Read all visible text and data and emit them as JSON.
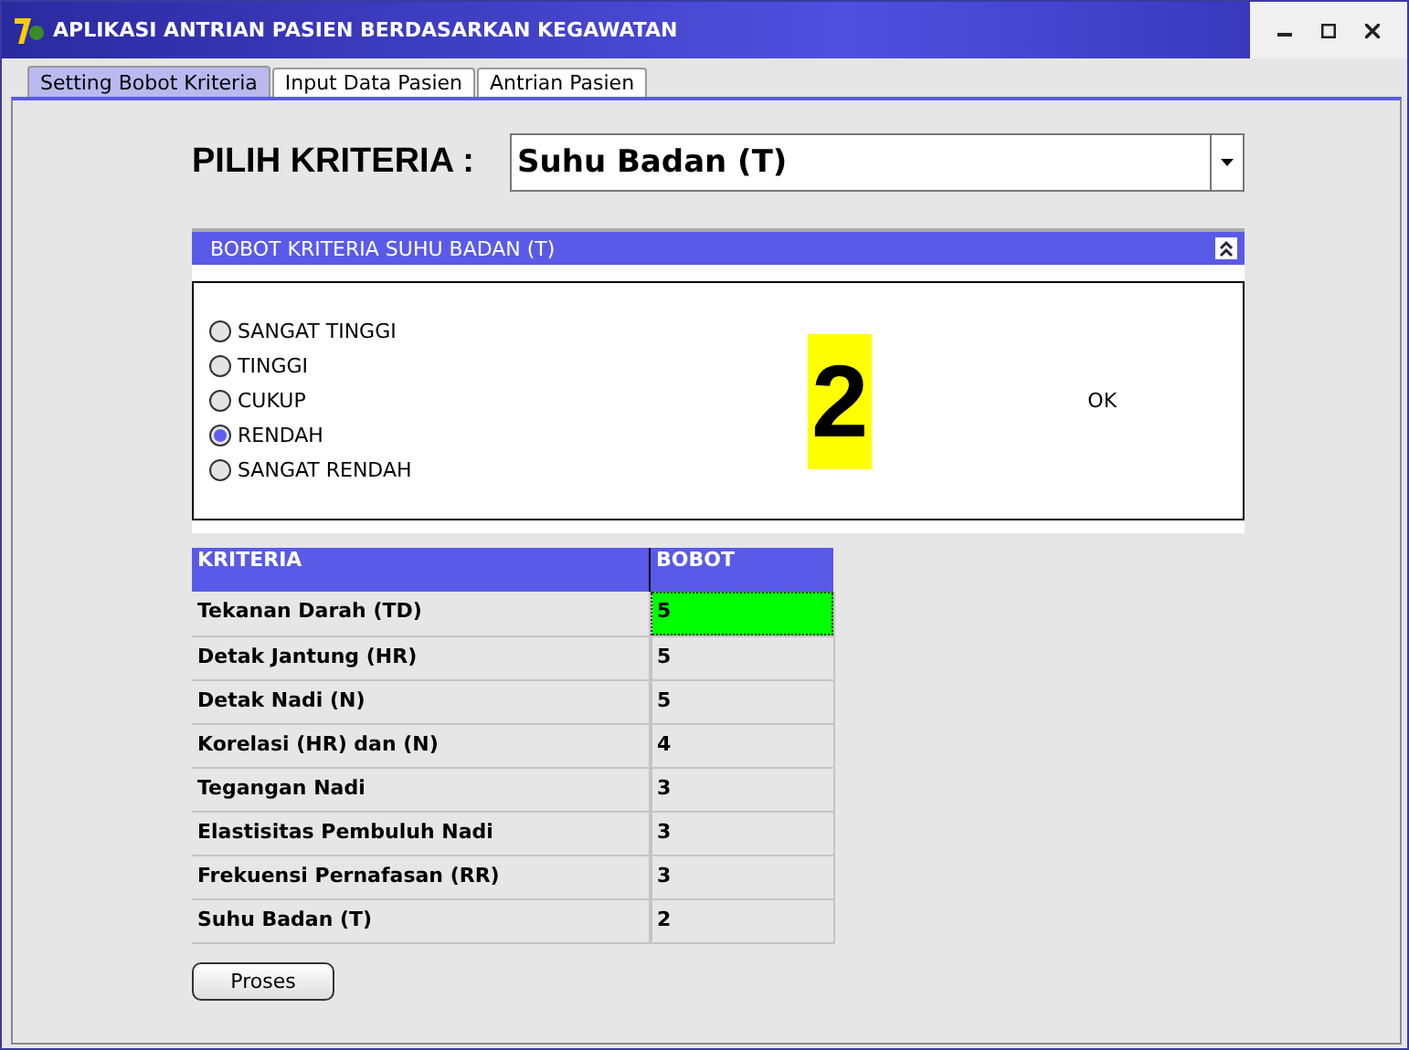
{
  "window": {
    "title": "APLIKASI ANTRIAN PASIEN BERDASARKAN KEGAWATAN"
  },
  "tabs": [
    {
      "label": "Setting Bobot Kriteria",
      "selected": true
    },
    {
      "label": "Input Data Pasien",
      "selected": false
    },
    {
      "label": "Antrian Pasien",
      "selected": false
    }
  ],
  "criteria_picker": {
    "label": "PILIH KRITERIA :",
    "value": "Suhu Badan (T)"
  },
  "weight_panel": {
    "title": "BOBOT KRITERIA SUHU BADAN (T)",
    "expanded": true,
    "options": [
      {
        "label": "SANGAT TINGGI",
        "selected": false
      },
      {
        "label": "TINGGI",
        "selected": false
      },
      {
        "label": "CUKUP",
        "selected": false
      },
      {
        "label": "RENDAH",
        "selected": true
      },
      {
        "label": "SANGAT RENDAH",
        "selected": false
      }
    ],
    "value": "2",
    "status": "OK"
  },
  "table": {
    "columns": [
      "KRITERIA",
      "BOBOT"
    ],
    "rows": [
      {
        "criteria": "Tekanan Darah (TD)",
        "weight": "5",
        "selected": true
      },
      {
        "criteria": "Detak Jantung (HR)",
        "weight": "5",
        "selected": false
      },
      {
        "criteria": "Detak Nadi (N)",
        "weight": "5",
        "selected": false
      },
      {
        "criteria": "Korelasi (HR) dan (N)",
        "weight": "4",
        "selected": false
      },
      {
        "criteria": "Tegangan Nadi",
        "weight": "3",
        "selected": false
      },
      {
        "criteria": "Elastisitas Pembuluh Nadi",
        "weight": "3",
        "selected": false
      },
      {
        "criteria": "Frekuensi Pernafasan (RR)",
        "weight": "3",
        "selected": false
      },
      {
        "criteria": "Suhu Badan (T)",
        "weight": "2",
        "selected": false
      }
    ]
  },
  "buttons": [
    "Proses"
  ]
}
